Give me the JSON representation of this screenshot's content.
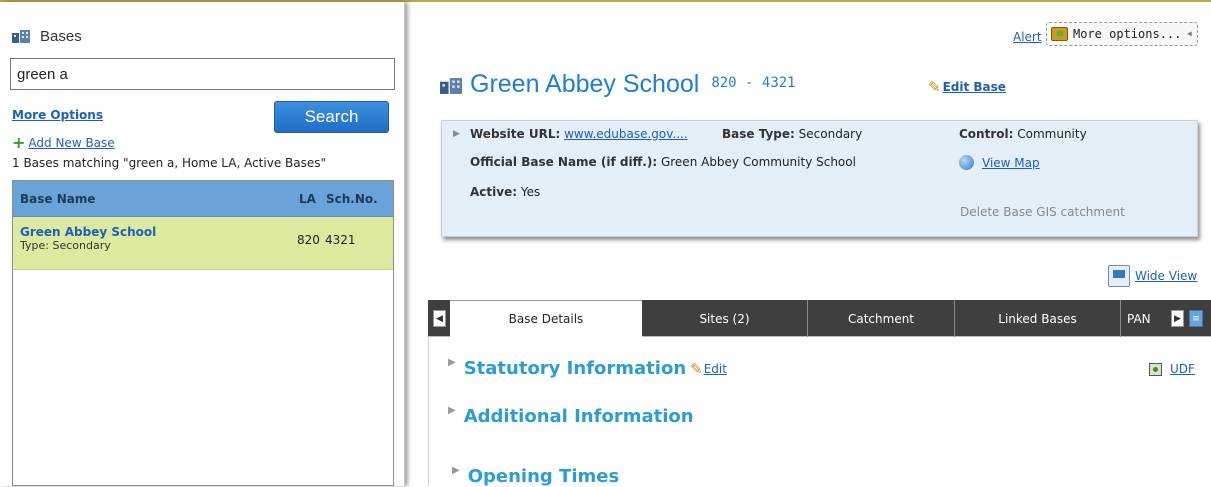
{
  "left_panel": {
    "title": "Bases",
    "search_value": "green a",
    "more_options": "More Options",
    "search_button": "Search",
    "add_new_base": "Add New Base",
    "match_text": "1 Bases matching \"green a, Home LA, Active Bases\"",
    "columns": {
      "name": "Base Name",
      "la": "LA",
      "sch_no": "Sch.No."
    },
    "rows": [
      {
        "name": "Green Abbey School",
        "type": "Type: Secondary",
        "la": "820",
        "sch_no": "4321"
      }
    ]
  },
  "top_right": {
    "alert": "Alert",
    "more_options": "More options...",
    "chevron": "◂"
  },
  "school": {
    "name": "Green Abbey School",
    "code": "820 - 4321",
    "edit_base": "Edit Base"
  },
  "info": {
    "website_label": "Website URL:",
    "website_value": "www.edubase.gov....",
    "base_type_label": "Base Type:",
    "base_type_value": "Secondary",
    "control_label": "Control:",
    "control_value": "Community",
    "official_name_label": "Official Base Name (if diff.):",
    "official_name_value": "Green Abbey Community School",
    "view_map": "View Map",
    "active_label": "Active:",
    "active_value": "Yes",
    "delete_gis": "Delete Base GIS catchment"
  },
  "wide_view": "Wide View",
  "tabs": [
    {
      "label": "Base Details",
      "active": true
    },
    {
      "label": "Sites (2)",
      "active": false
    },
    {
      "label": "Catchment",
      "active": false
    },
    {
      "label": "Linked Bases",
      "active": false
    },
    {
      "label": "PAN",
      "active": false
    }
  ],
  "sections": {
    "statutory": "Statutory Information",
    "edit": "Edit",
    "udf": "UDF",
    "additional": "Additional Information",
    "opening": "Opening Times"
  },
  "colors": {
    "accent_blue": "#1e7fd0",
    "section_blue": "#2d9bd9",
    "selected_row": "#dde99f",
    "list_header": "#6aa3d8",
    "tab_bar": "#3f3f3f"
  }
}
